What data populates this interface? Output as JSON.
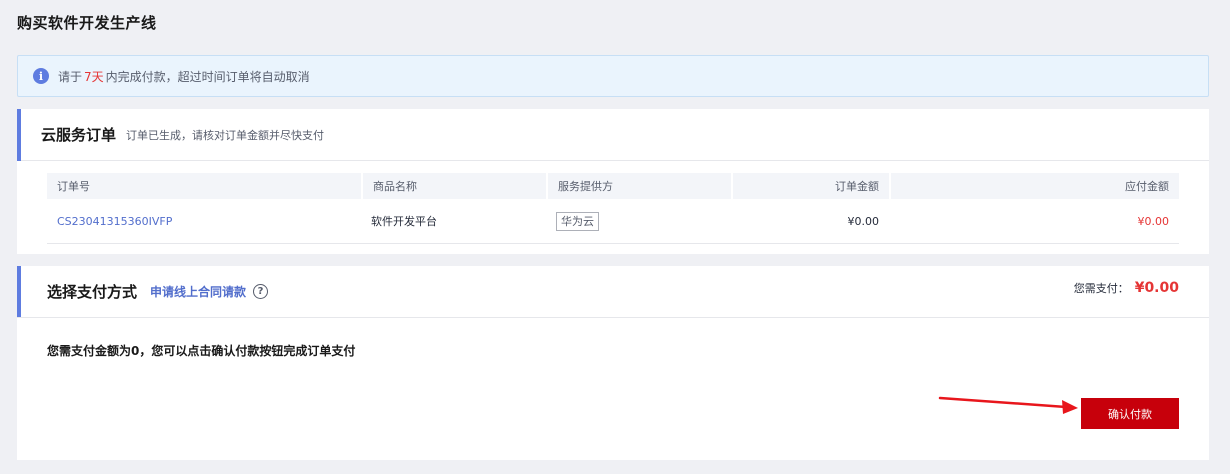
{
  "page_title": "购买软件开发生产线",
  "notice": {
    "prefix": "请于",
    "days": "7天",
    "suffix": "内完成付款，超过时间订单将自动取消",
    "icon": "info-icon"
  },
  "order_section": {
    "title": "云服务订单",
    "subtitle": "订单已生成，请核对订单金额并尽快支付",
    "columns": [
      "订单号",
      "商品名称",
      "服务提供方",
      "订单金额",
      "应付金额"
    ],
    "rows": [
      {
        "order_no": "CS23041315360IVFP",
        "product": "软件开发平台",
        "provider": "华为云",
        "order_amount": "¥0.00",
        "payable_amount": "¥0.00"
      }
    ]
  },
  "payment_section": {
    "title": "选择支付方式",
    "contract_link": "申请线上合同请款",
    "help_icon": "?",
    "total_label": "您需支付：",
    "total_amount": "¥0.00",
    "note": "您需支付金额为0，您可以点击确认付款按钮完成订单支付",
    "confirm_label": "确认付款"
  },
  "colors": {
    "accent": "#5e7ce0",
    "primary_button": "#c7000b",
    "price_red": "#e53535",
    "link": "#526ecc"
  }
}
